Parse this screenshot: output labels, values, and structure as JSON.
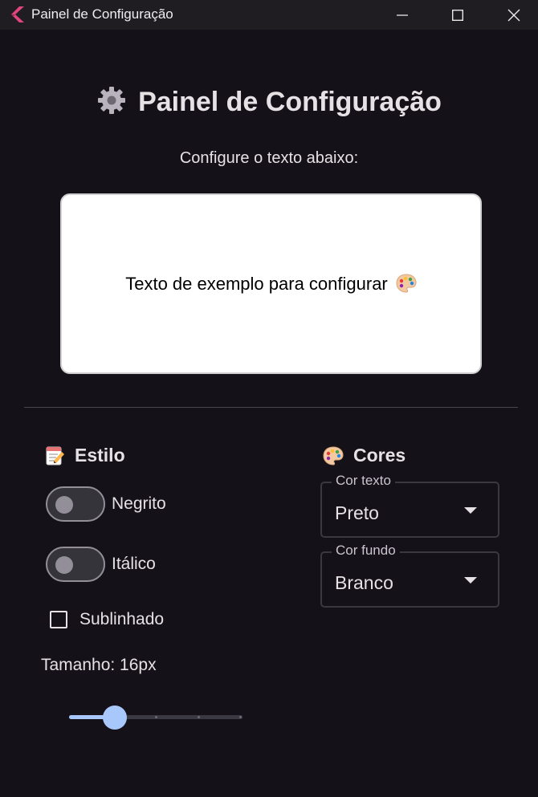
{
  "window": {
    "title": "Painel de Configuração",
    "controls": {
      "minimize_icon": "minimize-icon",
      "maximize_icon": "maximize-icon",
      "close_icon": "close-icon"
    }
  },
  "header": {
    "icon": "gear-icon",
    "title": "Painel de Configuração",
    "subtitle": "Configure o texto abaixo:"
  },
  "preview": {
    "text": "Texto de exemplo para configurar",
    "icon": "palette-icon",
    "background": "#ffffff",
    "text_color": "#000000"
  },
  "style_section": {
    "icon": "memo-icon",
    "title": "Estilo",
    "bold": {
      "label": "Negrito",
      "on": false
    },
    "italic": {
      "label": "Itálico",
      "on": false
    },
    "underline": {
      "label": "Sublinhado",
      "checked": false
    },
    "size_label": "Tamanho: 16px",
    "size_slider": {
      "value_fraction": 0.25,
      "divisions": 4
    }
  },
  "colors_section": {
    "icon": "palette-icon",
    "title": "Cores",
    "text_color": {
      "label": "Cor texto",
      "value": "Preto"
    },
    "background_color": {
      "label": "Cor fundo",
      "value": "Branco"
    }
  },
  "colors": {
    "accent": "#a8c7fa",
    "background": "#141218",
    "titlebar": "#1f1d22"
  }
}
